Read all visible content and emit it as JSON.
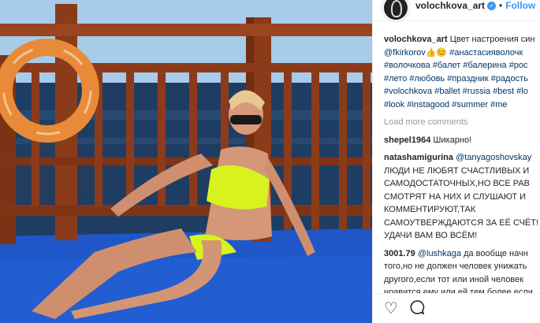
{
  "header": {
    "username": "volochkova_art",
    "separator": "•",
    "follow_label": "Follow",
    "avatar_icon": "avatar-icon",
    "verified_icon": "verified-badge-icon"
  },
  "caption": {
    "user": "volochkova_art",
    "text": "Цвет настроения син",
    "mention": "@fkirkorov",
    "emojis": "👍😊",
    "hashtags_line1": "#анастасияволочк",
    "hashtags_line2": "#волочкова #балет #балерина #рос",
    "hashtags_line3": "#лето #любовь #праздник #радость",
    "hashtags_line4": "#volochkova #ballet #russia #best #lo",
    "hashtags_line5": "#look #instagood #summer #me"
  },
  "load_more": "Load more comments",
  "comments": [
    {
      "user": "shepel1964",
      "text": "Шикарно!"
    },
    {
      "user": "natashamigurina",
      "mention": "@tanyagoshovskay",
      "text": "ЛЮДИ НЕ ЛЮБЯТ СЧАСТЛИВЫХ И САМОДОСТАТОЧНЫХ,НО ВСЕ РАВ СМОТРЯТ НА НИХ И СЛУШАЮТ И КОММЕНТИРУЮТ,ТАК САМОУТВЕРЖДАЮТСЯ ЗА ЕЁ СЧЁТ!УДАЧИ ВАМ ВО ВСЁМ!"
    },
    {
      "user": "3001.79",
      "mention": "@lushkaga",
      "text": "да вообще начн того,но не должен человек унижать другого,если тот или иной человек нравится ему или ей тем более если"
    }
  ],
  "actions": {
    "like_icon": "heart-icon",
    "comment_icon": "comment-icon"
  },
  "colors": {
    "link": "#003569",
    "follow": "#3897f0",
    "text": "#262626",
    "muted": "#999999",
    "sea": "#1f3d63",
    "sky": "#9ec3e4",
    "deck": "#1f57c9",
    "bikini": "#d8f21d"
  }
}
